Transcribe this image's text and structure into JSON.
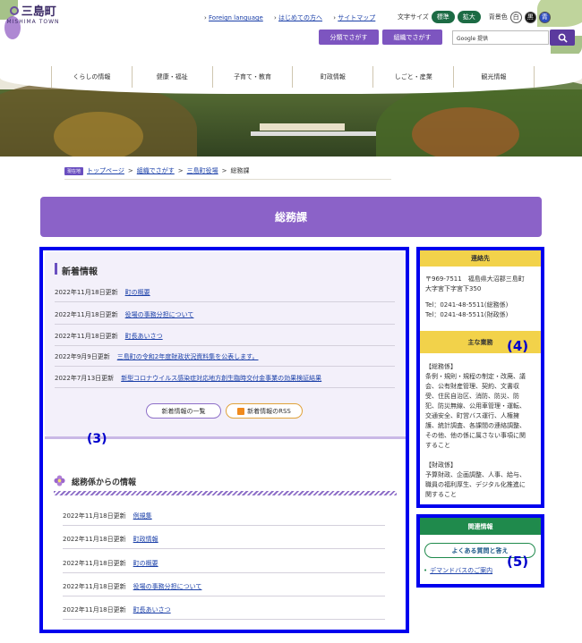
{
  "header": {
    "logo_jp": "三島町",
    "logo_en": "MISHIMA TOWN",
    "links": [
      "Foreign language",
      "はじめての方へ",
      "サイトマップ"
    ],
    "font_size_label": "文字サイズ",
    "size_standard": "標準",
    "size_large": "拡大",
    "color_label": "背景色",
    "colors": [
      "白",
      "黒",
      "青"
    ],
    "btn_category": "分類でさがす",
    "btn_org": "組織でさがす",
    "search_placeholder": "Google 提供"
  },
  "nav": [
    "くらしの情報",
    "健康・福祉",
    "子育て・教育",
    "町政情報",
    "しごと・産業",
    "観光情報"
  ],
  "breadcrumb": {
    "tag": "現在地",
    "items": [
      "トップページ",
      "組織でさがす",
      "三島町役場"
    ],
    "current": "総務課"
  },
  "page_title": "総務課",
  "news": {
    "title": "新着情報",
    "items": [
      {
        "date": "2022年11月18日更新",
        "text": "町の概要"
      },
      {
        "date": "2022年11月18日更新",
        "text": "役場の事務分担について"
      },
      {
        "date": "2022年11月18日更新",
        "text": "町長あいさつ"
      },
      {
        "date": "2022年9月9日更新",
        "text": "三島町の令和2年度財政状況資料集を公表します。"
      },
      {
        "date": "2022年7月13日更新",
        "text": "新型コロナウイルス感染症対応地方創生臨時交付金事業の効果検証結果"
      }
    ],
    "btn_list": "新着情報の一覧",
    "btn_rss": "新着情報のRSS"
  },
  "label3": "(3)",
  "label4": "(4)",
  "label5": "(5)",
  "section2": {
    "title": "総務係からの情報",
    "items": [
      {
        "date": "2022年11月18日更新",
        "text": "例規集"
      },
      {
        "date": "2022年11月18日更新",
        "text": "町政情報"
      },
      {
        "date": "2022年11月18日更新",
        "text": "町の概要"
      },
      {
        "date": "2022年11月18日更新",
        "text": "役場の事務分担について"
      },
      {
        "date": "2022年11月18日更新",
        "text": "町長あいさつ"
      }
    ]
  },
  "contact": {
    "title": "連絡先",
    "lines": [
      "〒969-7511　福島県大沼郡三島町",
      "大字宮下字宮下350",
      "",
      "Tel：0241-48-5511(総務係)",
      "Tel：0241-48-5511(財政係)"
    ]
  },
  "duties": {
    "title": "主な業務",
    "lines": [
      "【総務係】",
      "条例・規則・規程の制定・改廃、議",
      "会、公有財産管理、契約、文書収",
      "受、住民自治区、消防、防災、防",
      "犯、防災無線、公用車管理・運転、",
      "交通安全、町営バス運行、人権擁",
      "護、統計調査、各課間の連絡調整、",
      "その他、他の係に属さない事項に関",
      "すること",
      "",
      "【財政係】",
      "予算財政、企画調整、人事、給与、",
      "職員の福利厚生、デジタル化推進に",
      "関すること"
    ]
  },
  "related": {
    "title": "関連情報",
    "faq": "よくある質問と答え",
    "link": "デマンドバスのご案内"
  }
}
